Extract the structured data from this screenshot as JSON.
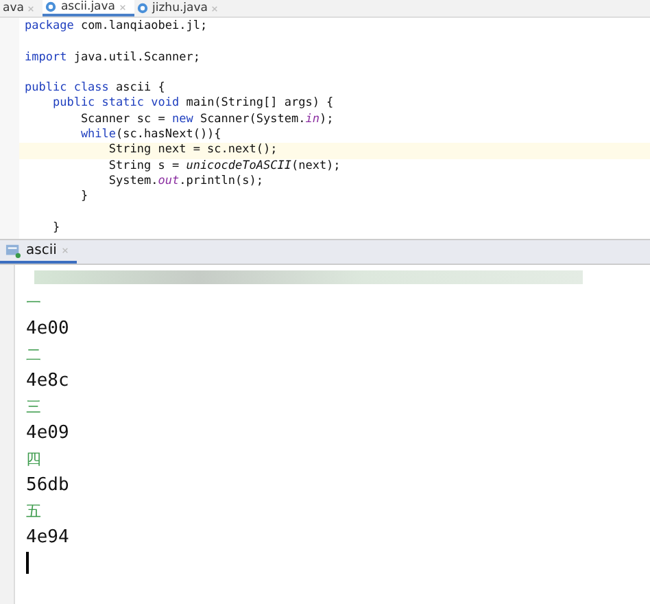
{
  "editor_tabs": [
    {
      "label": "ava",
      "selected": false
    },
    {
      "label": "ascii.java",
      "selected": true
    },
    {
      "label": "jizhu.java",
      "selected": false
    }
  ],
  "code_lines": [
    {
      "highlighted": false,
      "segments": [
        {
          "kind": "keyword",
          "text": "package"
        },
        {
          "kind": "plain",
          "text": " com.lanqiaobei.jl;"
        }
      ]
    },
    {
      "highlighted": false
    },
    {
      "highlighted": false,
      "segments": [
        {
          "kind": "keyword",
          "text": "import"
        },
        {
          "kind": "plain",
          "text": " java.util.Scanner;"
        }
      ]
    },
    {
      "highlighted": false
    },
    {
      "highlighted": false,
      "segments": [
        {
          "kind": "keyword",
          "text": "public class"
        },
        {
          "kind": "plain",
          "text": " ascii {"
        }
      ]
    },
    {
      "highlighted": false,
      "segments": [
        {
          "kind": "keyword",
          "text": "    public static void"
        },
        {
          "kind": "plain",
          "text": " main(String[] args) {"
        }
      ]
    },
    {
      "highlighted": false,
      "segments": [
        {
          "kind": "plain",
          "text": "        Scanner sc = "
        },
        {
          "kind": "keyword",
          "text": "new"
        },
        {
          "kind": "plain",
          "text": " Scanner(System."
        },
        {
          "kind": "field",
          "text": "in"
        },
        {
          "kind": "plain",
          "text": ");"
        }
      ]
    },
    {
      "highlighted": false,
      "segments": [
        {
          "kind": "keyword",
          "text": "        while"
        },
        {
          "kind": "plain",
          "text": "(sc.hasNext()){"
        }
      ]
    },
    {
      "highlighted": true,
      "segments": [
        {
          "kind": "plain",
          "text": "            String next = sc.next();"
        }
      ]
    },
    {
      "highlighted": false,
      "segments": [
        {
          "kind": "plain",
          "text": "            String s = "
        },
        {
          "kind": "static",
          "text": "unicocdeToASCII"
        },
        {
          "kind": "plain",
          "text": "(next);"
        }
      ]
    },
    {
      "highlighted": false,
      "segments": [
        {
          "kind": "plain",
          "text": "            System."
        },
        {
          "kind": "field",
          "text": "out"
        },
        {
          "kind": "plain",
          "text": ".println(s);"
        }
      ]
    },
    {
      "highlighted": false,
      "segments": [
        {
          "kind": "plain",
          "text": "        }"
        }
      ]
    },
    {
      "highlighted": false
    },
    {
      "highlighted": false,
      "segments": [
        {
          "kind": "plain",
          "text": "    }"
        }
      ]
    }
  ],
  "console_tabs": [
    {
      "label": "ascii",
      "selected": true
    }
  ],
  "console_lines": [
    {
      "kind": "input",
      "text": "一"
    },
    {
      "kind": "output",
      "text": "4e00"
    },
    {
      "kind": "input",
      "text": "二"
    },
    {
      "kind": "output",
      "text": "4e8c"
    },
    {
      "kind": "input",
      "text": "三"
    },
    {
      "kind": "output",
      "text": "4e09"
    },
    {
      "kind": "input",
      "text": "四"
    },
    {
      "kind": "output",
      "text": "56db"
    },
    {
      "kind": "input",
      "text": "五"
    },
    {
      "kind": "output",
      "text": "4e94"
    }
  ]
}
